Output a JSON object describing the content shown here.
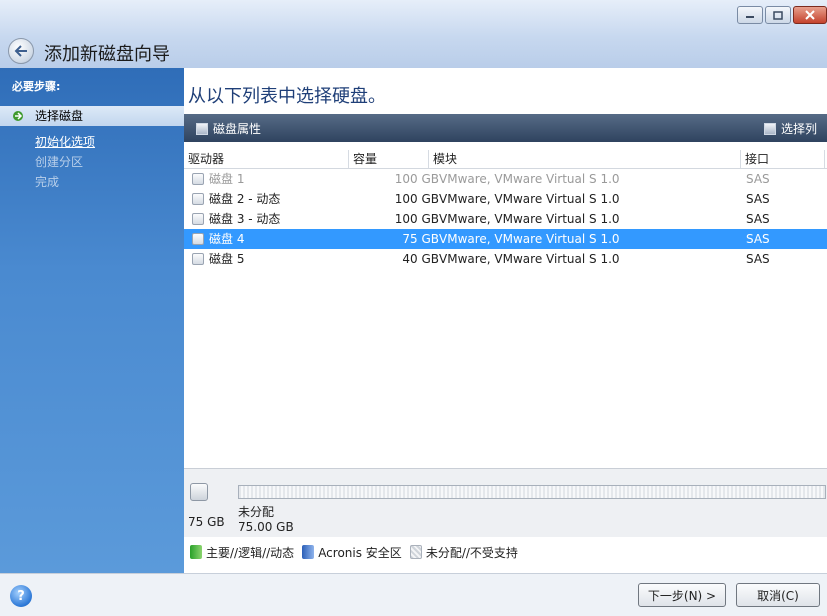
{
  "window": {
    "title": "添加新磁盘向导",
    "buttons": [
      "minimize",
      "maximize",
      "close"
    ]
  },
  "sidebar": {
    "header": "必要步骤:",
    "steps": [
      {
        "label": "选择磁盘",
        "state": "current"
      },
      {
        "label": "初始化选项",
        "state": "link"
      },
      {
        "label": "创建分区",
        "state": "disabled"
      },
      {
        "label": "完成",
        "state": "disabled"
      }
    ]
  },
  "main": {
    "heading": "从以下列表中选择硬盘。",
    "toolbar": {
      "disk_properties": "磁盘属性",
      "select_columns": "选择列"
    },
    "grid": {
      "columns": [
        "驱动器",
        "容量",
        "模块",
        "接口"
      ],
      "rows": [
        {
          "name": "磁盘 1",
          "capacity": "100 GB",
          "model": "VMware, VMware Virtual S 1.0",
          "interface": "SAS",
          "state": "disabled"
        },
        {
          "name": "磁盘 2 - 动态",
          "capacity": "100 GB",
          "model": "VMware, VMware Virtual S 1.0",
          "interface": "SAS",
          "state": "normal"
        },
        {
          "name": "磁盘 3 - 动态",
          "capacity": "100 GB",
          "model": "VMware, VMware Virtual S 1.0",
          "interface": "SAS",
          "state": "normal"
        },
        {
          "name": "磁盘 4",
          "capacity": "75 GB",
          "model": "VMware, VMware Virtual S 1.0",
          "interface": "SAS",
          "state": "selected"
        },
        {
          "name": "磁盘 5",
          "capacity": "40 GB",
          "model": "VMware, VMware Virtual S 1.0",
          "interface": "SAS",
          "state": "normal"
        }
      ]
    },
    "disk_map": {
      "disk_size": "75 GB",
      "partition_label": "未分配",
      "partition_size": "75.00 GB"
    },
    "legend": {
      "primary": "主要//逻辑//动态",
      "acronis": "Acronis 安全区",
      "unallocated": "未分配//不受支持"
    }
  },
  "footer": {
    "help_icon": "?",
    "next": "下一步(N) >",
    "cancel": "取消(C)"
  },
  "colors": {
    "selection": "#3399ff",
    "sidebar": "#4a8ad0",
    "heading": "#1f3f78"
  }
}
